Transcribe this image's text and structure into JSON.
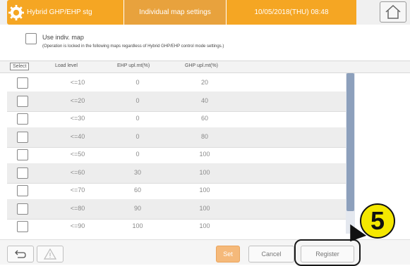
{
  "header": {
    "app_title": "Hybrid GHP/EHP stg",
    "screen_title": "Individual map settings",
    "datetime": "10/05/2018(THU) 08:48",
    "home_icon": "home-icon",
    "settings_icon": "gear-icon",
    "accent_color": "#f5a623"
  },
  "options": {
    "use_indiv_map_label": "Use indiv. map",
    "note": "(Operation is locked in the following maps regardless of Hybrid GHP/EHP control mode settings.)"
  },
  "columns": {
    "select": "Select",
    "load_level": "Load level",
    "ehp": "EHP upl.mt(%)",
    "ghp": "GHP upl.mt(%)"
  },
  "rows": [
    {
      "load": "<=10",
      "ehp": "0",
      "ghp": "20"
    },
    {
      "load": "<=20",
      "ehp": "0",
      "ghp": "40"
    },
    {
      "load": "<=30",
      "ehp": "0",
      "ghp": "60"
    },
    {
      "load": "<=40",
      "ehp": "0",
      "ghp": "80"
    },
    {
      "load": "<=50",
      "ehp": "0",
      "ghp": "100"
    },
    {
      "load": "<=60",
      "ehp": "30",
      "ghp": "100"
    },
    {
      "load": "<=70",
      "ehp": "60",
      "ghp": "100"
    },
    {
      "load": "<=80",
      "ehp": "90",
      "ghp": "100"
    },
    {
      "load": "<=90",
      "ehp": "100",
      "ghp": "100"
    }
  ],
  "footer": {
    "back_icon": "back-arrow-icon",
    "warning_icon": "warning-icon",
    "set_label": "Set",
    "cancel_label": "Cancel",
    "register_label": "Register"
  },
  "callout": {
    "number": "5"
  }
}
